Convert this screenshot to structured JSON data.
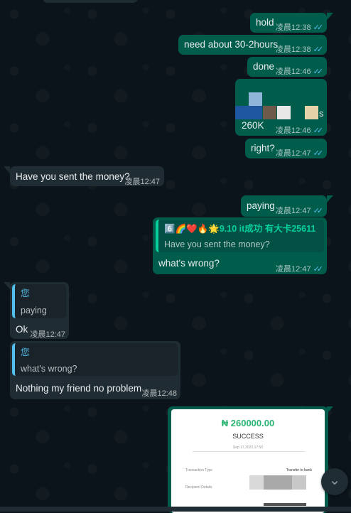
{
  "messages": [
    {
      "text": "hold",
      "time": "凌晨12:38",
      "ticks": "✓✓"
    },
    {
      "text": "need about 30-2hours",
      "time": "凌晨12:38",
      "ticks": "✓✓"
    },
    {
      "text": "done",
      "time": "凌晨12:46",
      "ticks": "✓✓"
    },
    {
      "text": "260K",
      "trailing": "s",
      "time": "凌晨12:46",
      "ticks": "✓✓"
    },
    {
      "text": "right?",
      "time": "凌晨12:47",
      "ticks": "✓✓"
    },
    {
      "text": "Have you sent the money?",
      "time": "凌晨12:47"
    },
    {
      "text": "paying",
      "time": "凌晨12:47",
      "ticks": "✓✓"
    },
    {
      "quote_name": "6️⃣🌈❤️🔥🌟9.10 it成功 有大卡25611",
      "quote_text": "Have you sent the money?",
      "text": "what's wrong?",
      "time": "凌晨12:47",
      "ticks": "✓✓"
    },
    {
      "quote_name": "您",
      "quote_text": "paying",
      "text": "Ok",
      "time": "凌晨12:47"
    },
    {
      "quote_name": "您",
      "quote_text": "what's wrong?",
      "text": "Nothing my friend no problem",
      "time": "凌晨12:48"
    }
  ],
  "receipt": {
    "amount": "₦ 260000.00",
    "status": "SUCCESS",
    "date": "Sep 17,2022,17:50",
    "row1_label": "Transaction Type",
    "row1_value": "Transfer to bank",
    "row2_label": "Recipient Details",
    "row3_label": "Sender Details"
  },
  "scroll_button": {
    "icon": "chevron-down-icon",
    "glyph": "⌄"
  },
  "colors": {
    "background": "#0b141a",
    "outgoing_bubble": "#005c4b",
    "incoming_bubble": "#202c33",
    "read_ticks": "#53bdeb",
    "receipt_amount": "#2bb673"
  }
}
